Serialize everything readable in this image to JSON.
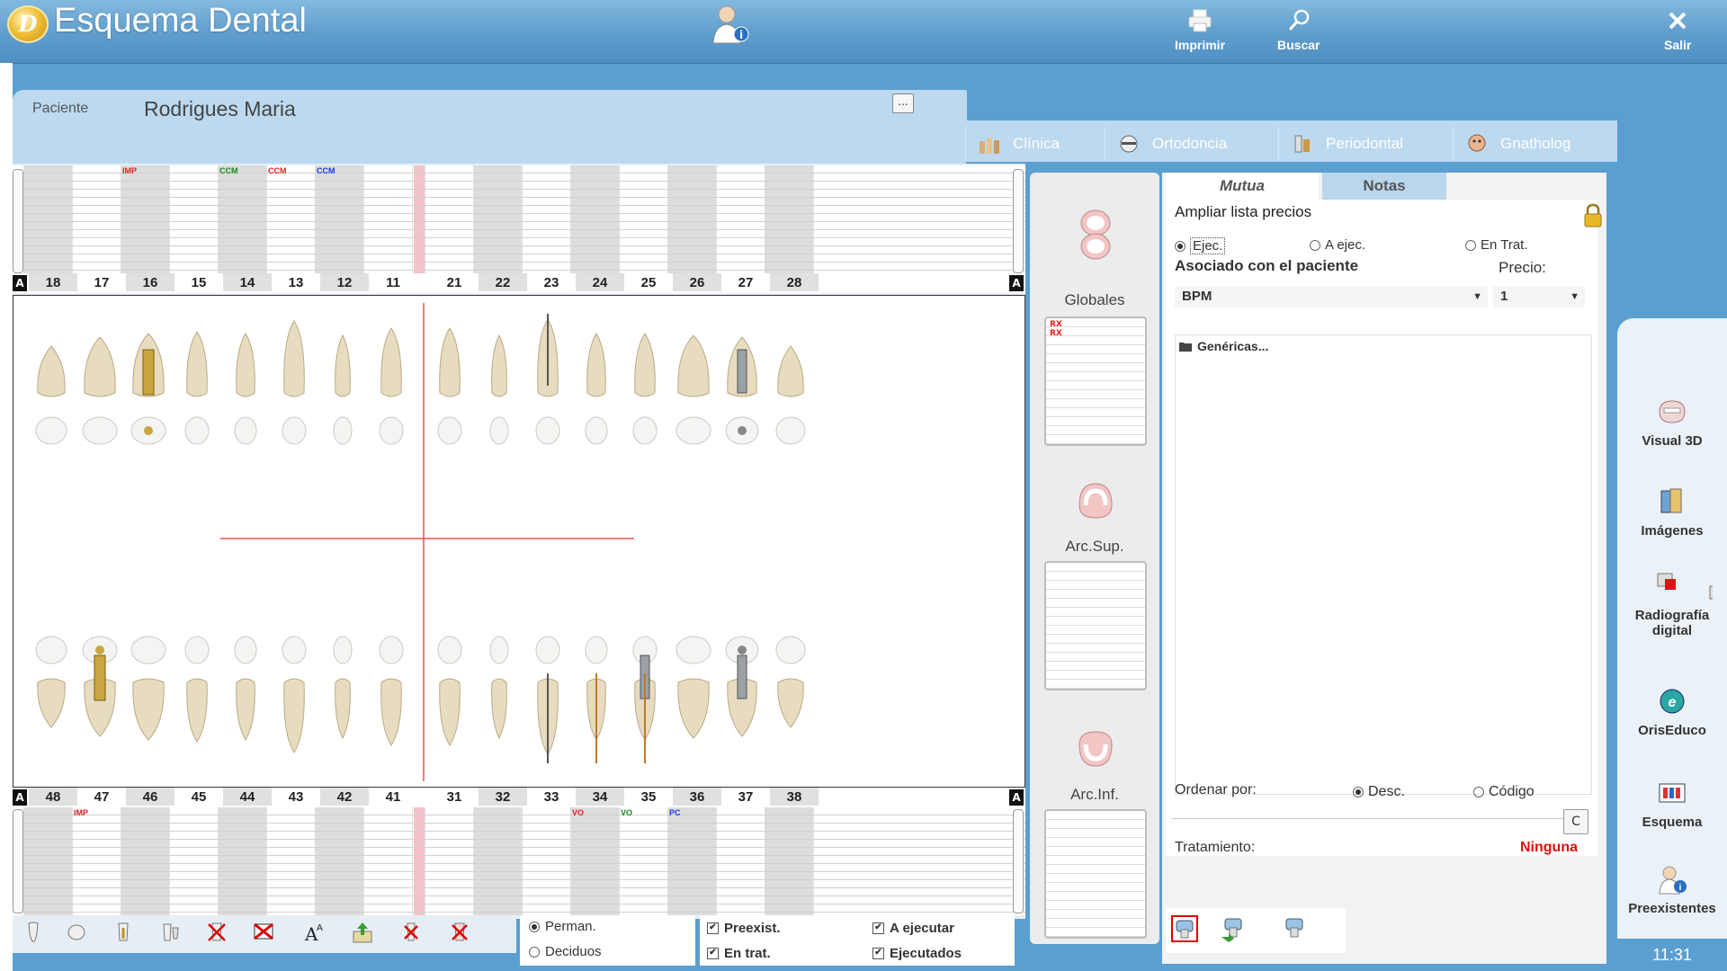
{
  "app": {
    "title": "Esquema Dental",
    "logo_letter": "D"
  },
  "topbar": {
    "print_label": "Imprimir",
    "search_label": "Buscar",
    "exit_label": "Salir"
  },
  "patient": {
    "label": "Paciente",
    "name": "Rodrigues Maria",
    "more_button": "..."
  },
  "tabs": [
    {
      "label": "Clínica",
      "icon": "clinic-icon"
    },
    {
      "label": "Ortodoncia",
      "icon": "orthodontics-icon"
    },
    {
      "label": "Periodontal",
      "icon": "periodontal-icon"
    },
    {
      "label": "Gnatholog",
      "icon": "gnathology-icon"
    }
  ],
  "chart": {
    "upper_numbers": [
      "18",
      "17",
      "16",
      "15",
      "14",
      "13",
      "12",
      "11",
      "21",
      "22",
      "23",
      "24",
      "25",
      "26",
      "27",
      "28"
    ],
    "lower_numbers": [
      "48",
      "47",
      "46",
      "45",
      "44",
      "43",
      "42",
      "41",
      "31",
      "32",
      "33",
      "34",
      "35",
      "36",
      "37",
      "38"
    ],
    "arch_marker": "A",
    "upper_marks": [
      {
        "col": 2,
        "text": "IMP",
        "color": "#e02020"
      },
      {
        "col": 4,
        "text": "CCM",
        "color": "#1a8a1a"
      },
      {
        "col": 5,
        "text": "CCM",
        "color": "#e02020"
      },
      {
        "col": 6,
        "text": "CCM",
        "color": "#1a3ae0"
      }
    ],
    "lower_marks": [
      {
        "col": 1,
        "text": "IMP",
        "color": "#e02020"
      },
      {
        "col": 11,
        "text": "VO",
        "color": "#e02020"
      },
      {
        "col": 12,
        "text": "VO",
        "color": "#1a8a1a"
      },
      {
        "col": 13,
        "text": "PC",
        "color": "#1a3ae0"
      }
    ]
  },
  "dentition": {
    "permanent": "Perman.",
    "deciduous": "Deciduos"
  },
  "filters": {
    "preexist": "Preexist.",
    "in_treatment": "En trat.",
    "to_execute": "A ejecutar",
    "executed": "Ejecutados"
  },
  "middle": {
    "global_label": "Globales",
    "global_items": [
      "RX",
      "RX"
    ],
    "upper_label": "Arc.Sup.",
    "lower_label": "Arc.Inf."
  },
  "right": {
    "tab_mutua": "Mutua",
    "tab_notas": "Notas",
    "expand_prices": "Ampliar lista precios",
    "radio_ejec": "Ejec.",
    "radio_a_ejec": "A ejec.",
    "radio_en_trat": "En Trat.",
    "associated_label": "Asociado con el paciente",
    "price_label": "Precio:",
    "insurer_value": "BPM",
    "price_value": "1",
    "tree_root": "Genéricas...",
    "order_by": "Ordenar por:",
    "order_desc": "Desc.",
    "order_code": "Código",
    "c_button": "C",
    "treatment_label": "Tratamiento:",
    "treatment_value": "Ninguna",
    "treatment_color": "#e01010"
  },
  "sidebar": [
    {
      "label": "Visual 3D",
      "icon": "visual-3d-icon"
    },
    {
      "label": "Imágenes",
      "icon": "images-icon"
    },
    {
      "label": "Radiografía digital",
      "icon": "digital-xray-icon"
    },
    {
      "label": "OrisEduco",
      "icon": "oriseduco-icon"
    },
    {
      "label": "Esquema",
      "icon": "scheme-icon"
    },
    {
      "label": "Preexistentes",
      "icon": "preexisting-icon"
    }
  ],
  "clock": "11:31"
}
